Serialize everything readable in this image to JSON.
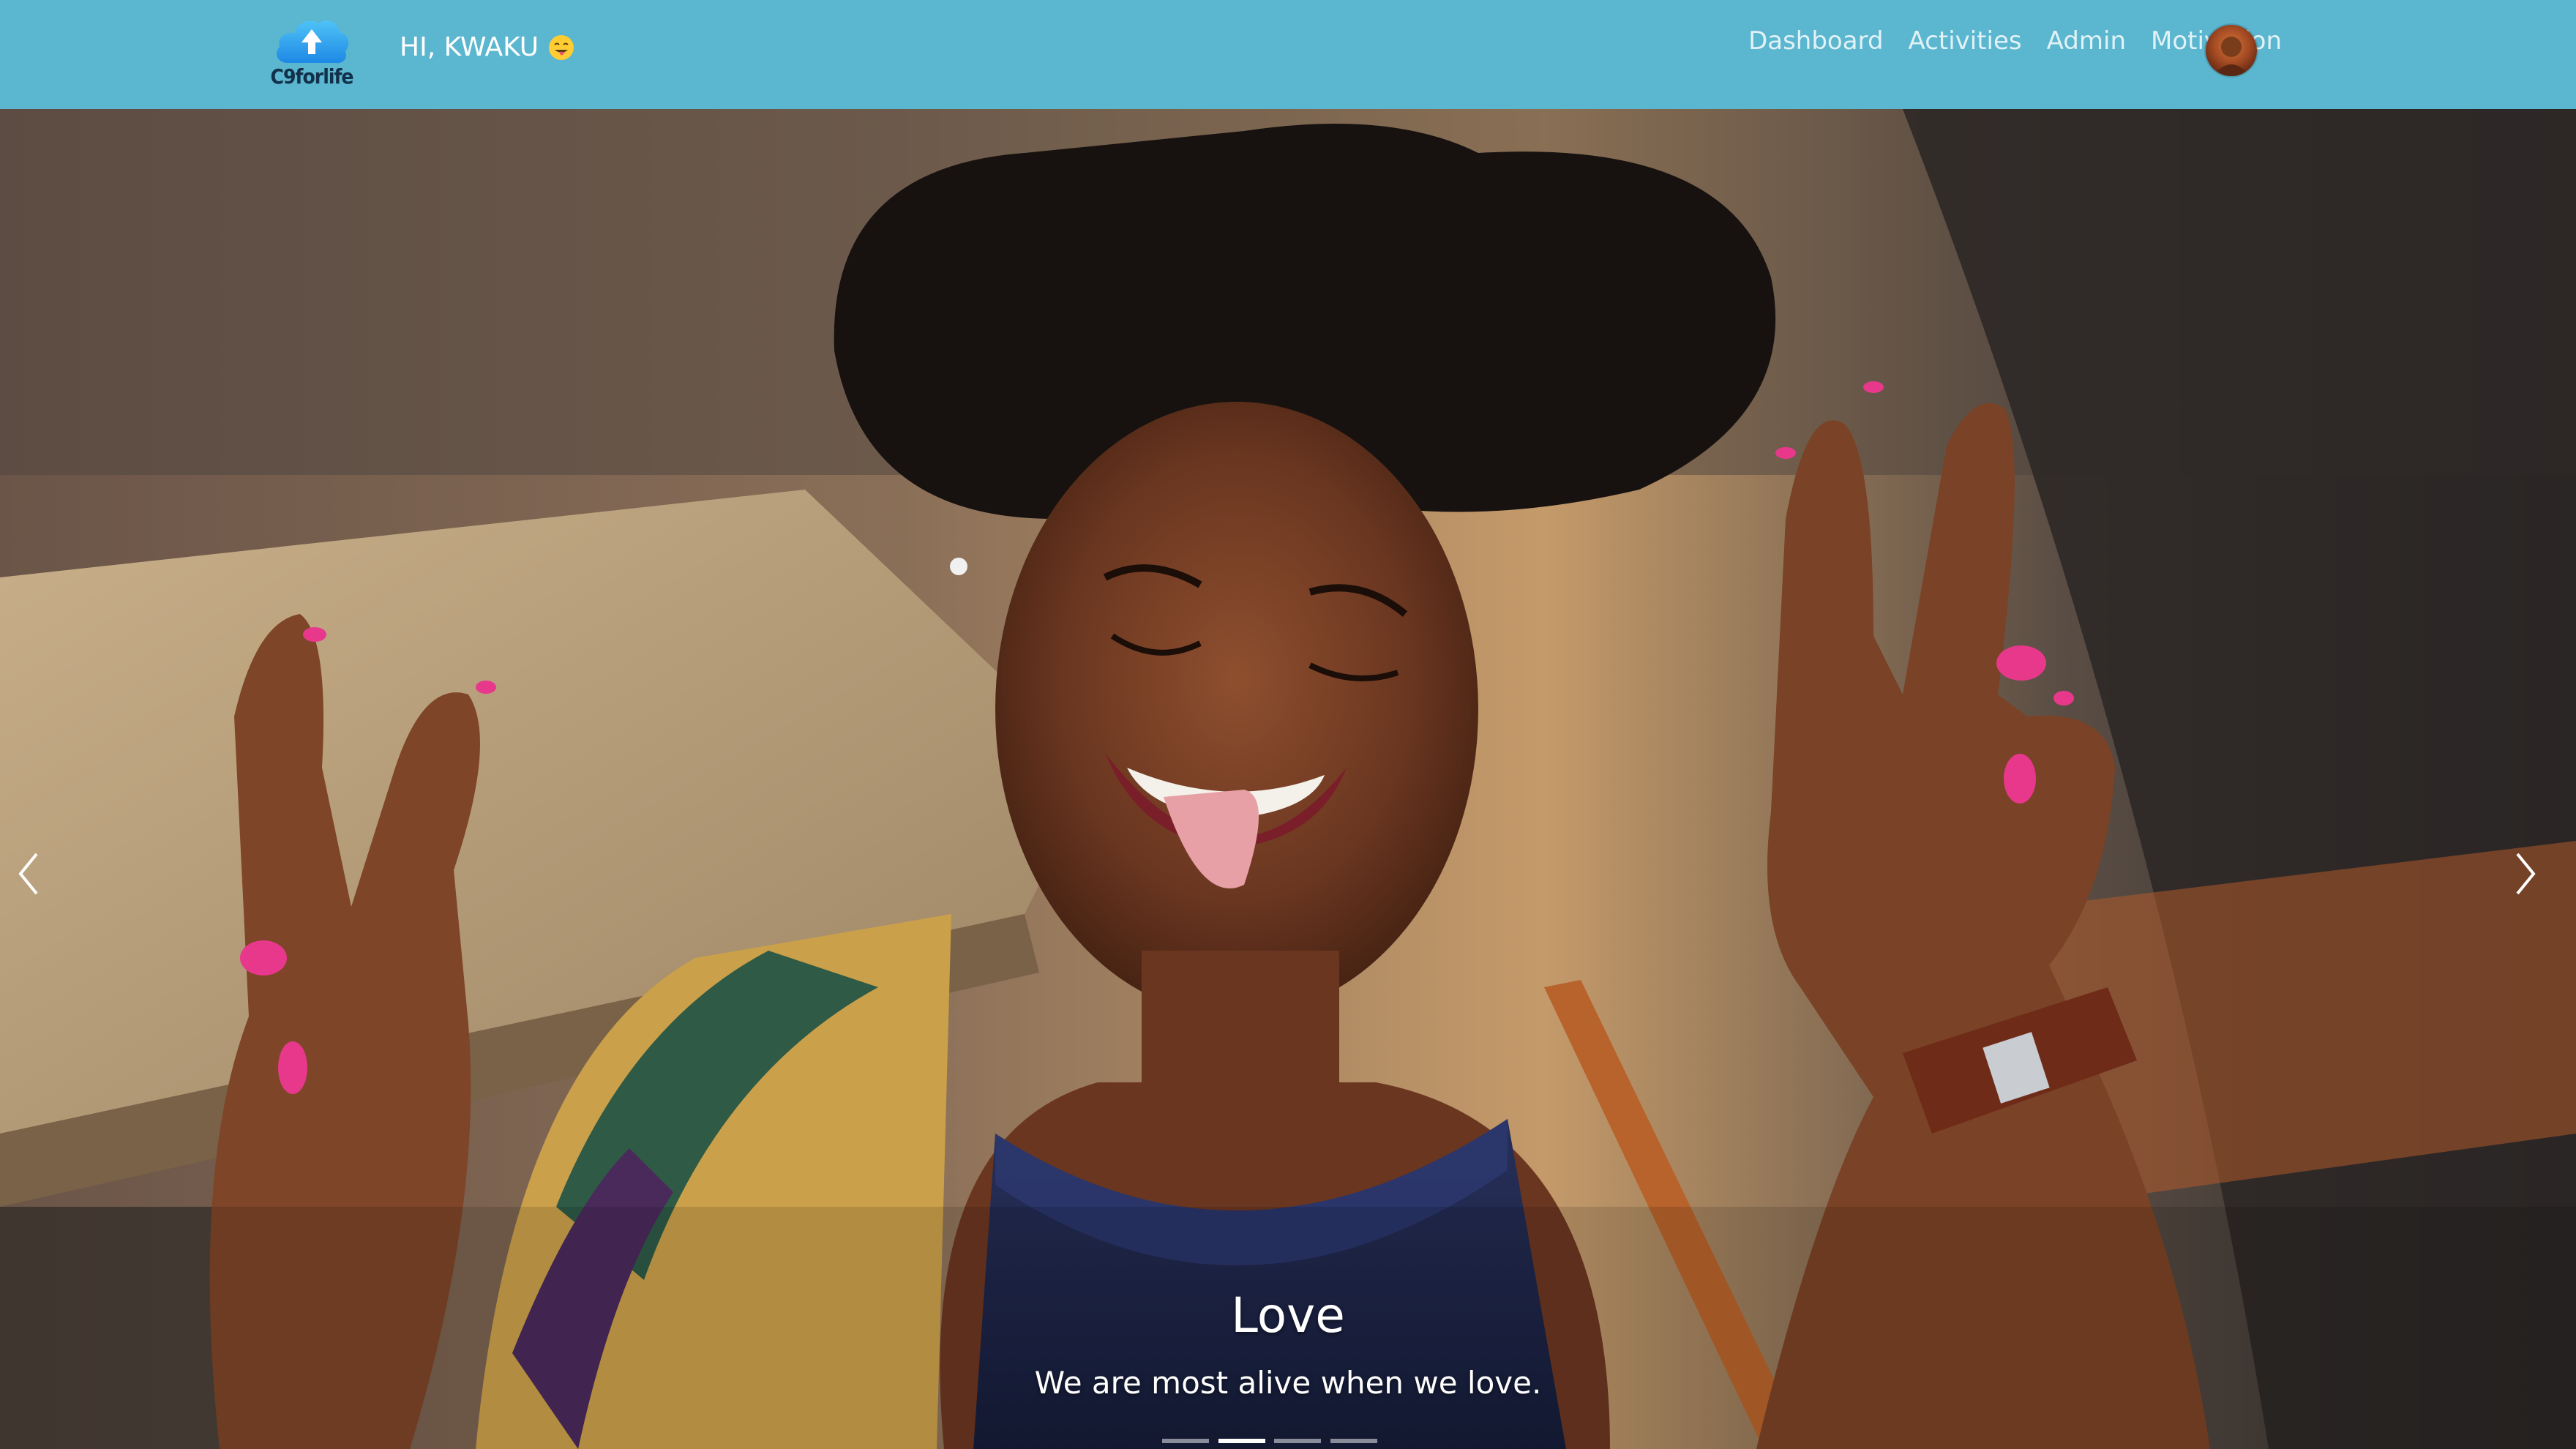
{
  "header": {
    "brand_name": "C9forlife",
    "greeting": "HI, KWAKU",
    "greeting_emoji": "face-with-tongue-icon",
    "nav": [
      {
        "label": "Dashboard"
      },
      {
        "label": "Activities"
      },
      {
        "label": "Admin"
      },
      {
        "label": "Motivation"
      }
    ],
    "colors": {
      "navbar": "#5bb6cf",
      "brand_cloud": "#2a9be0",
      "text": "#ffffff"
    }
  },
  "carousel": {
    "slides": 4,
    "active_slide": 2,
    "caption_title": "Love",
    "caption_text": "We are most alive when we love."
  }
}
